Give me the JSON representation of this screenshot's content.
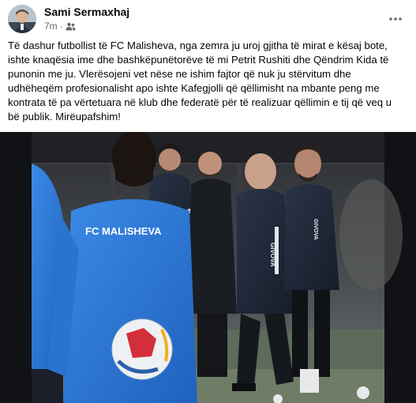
{
  "post": {
    "author": "Sami Sermaxhaj",
    "time": "7m",
    "separator": "·",
    "audience_icon": "friends-icon",
    "more_icon": "more-options-icon",
    "text_lines": [
      "Të dashur futbollist të FC Malisheva, nga zemra ju uroj gjitha të mirat e kësaj bote,",
      "ishte knaqësia ime dhe bashkëpunëtorëve të mi Petrit Rushiti dhe Qëndrim Kida të",
      "punonin me ju. Vlerësojeni vet nëse ne ishim fajtor që nuk ju stërvitum dhe",
      "udhëheqëm profesionalisht apo ishte Kafegjolli që qëllimisht na mbante peng me",
      "kontrata të pa vërtetuara në klub dhe federatë për të realizuar qëllimin e tij që veq u",
      "bë publik. Mirëupafshim!"
    ],
    "photo_text": {
      "shirt_left": "FC MALISHEVA",
      "brand_1": "GIVOVA",
      "brand_2": "GIVOVA",
      "brand_3": "GIVOVA"
    }
  },
  "colors": {
    "text": "#050505",
    "secondary": "#65676b",
    "kit_blue": "#2e78d6",
    "navy": "#1c2536"
  }
}
